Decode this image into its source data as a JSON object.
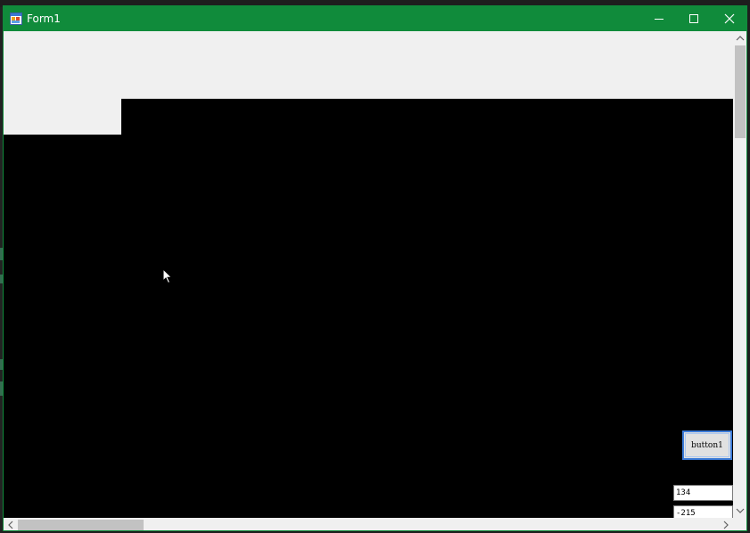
{
  "window": {
    "title": "Form1",
    "accent_color": "#108b3b"
  },
  "controls": {
    "button1_label": "button1",
    "field1_value": "134",
    "field2_value": "-215"
  },
  "icons": {
    "app": "app-icon",
    "minimize": "minimize-icon",
    "maximize": "maximize-icon",
    "close": "close-icon",
    "cursor": "mouse-pointer-icon"
  }
}
